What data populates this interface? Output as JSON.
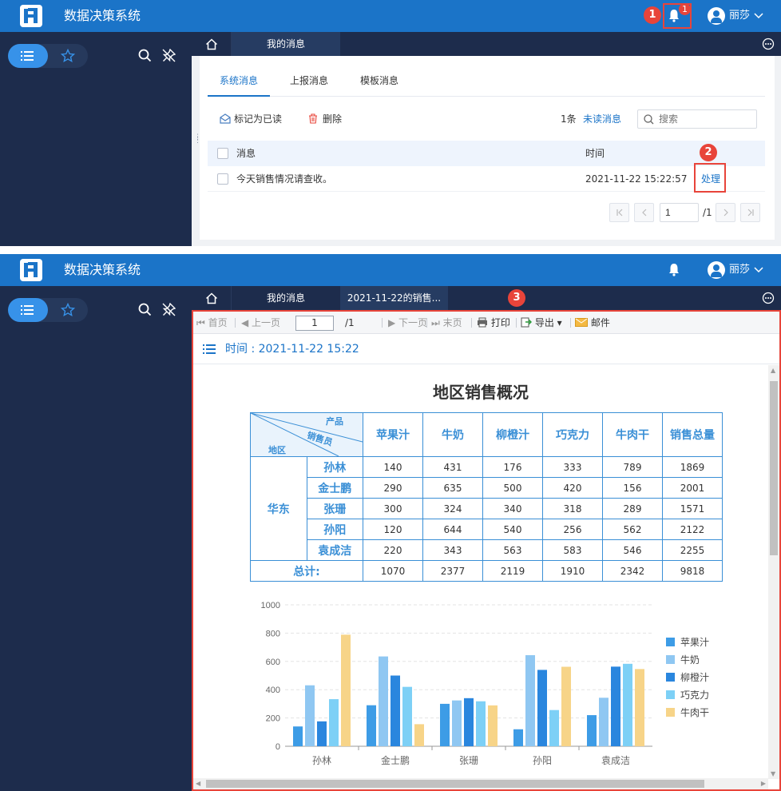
{
  "app": {
    "title": "数据决策系统",
    "user": "丽莎"
  },
  "notifications": {
    "count": "1"
  },
  "markers": {
    "m1": "1",
    "m2": "2",
    "m3": "3"
  },
  "tabs": {
    "messages": "我的消息",
    "report": "2021-11-22的销售..."
  },
  "subtabs": [
    "系统消息",
    "上报消息",
    "模板消息"
  ],
  "actions": {
    "mark_read": "标记为已读",
    "delete": "删除",
    "count": "1条",
    "unread": "未读消息",
    "search_placeholder": "搜索"
  },
  "table": {
    "headers": {
      "message": "消息",
      "time": "时间"
    },
    "rows": [
      {
        "message": "今天销售情况请查收。",
        "time": "2021-11-22 15:22:57",
        "action": "处理"
      }
    ]
  },
  "pager": {
    "page": "1",
    "total": "/1"
  },
  "viewer": {
    "toolbar": {
      "first": "首页",
      "prev": "上一页",
      "page": "1",
      "total": "/1",
      "next": "下一页",
      "last": "末页",
      "print": "打印",
      "export": "导出",
      "mail": "邮件"
    },
    "time": "时间 : 2021-11-22 15:22"
  },
  "report": {
    "title": "地区销售概况",
    "corner": {
      "product": "产品",
      "salesperson": "销售员",
      "region": "地区"
    },
    "columns": [
      "苹果汁",
      "牛奶",
      "柳橙汁",
      "巧克力",
      "牛肉干",
      "销售总量"
    ],
    "region": "华东",
    "rows": [
      {
        "name": "孙林",
        "values": [
          "140",
          "431",
          "176",
          "333",
          "789",
          "1869"
        ]
      },
      {
        "name": "金士鹏",
        "values": [
          "290",
          "635",
          "500",
          "420",
          "156",
          "2001"
        ]
      },
      {
        "name": "张珊",
        "values": [
          "300",
          "324",
          "340",
          "318",
          "289",
          "1571"
        ]
      },
      {
        "name": "孙阳",
        "values": [
          "120",
          "644",
          "540",
          "256",
          "562",
          "2122"
        ]
      },
      {
        "name": "袁成洁",
        "values": [
          "220",
          "343",
          "563",
          "583",
          "546",
          "2255"
        ]
      }
    ],
    "total": {
      "label": "总计:",
      "values": [
        "1070",
        "2377",
        "2119",
        "1910",
        "2342",
        "9818"
      ]
    }
  },
  "colors": {
    "brand": "#1b74c8",
    "sidebar": "#1d2c4c",
    "alert": "#e8443a"
  },
  "chart_data": {
    "type": "bar",
    "categories": [
      "孙林",
      "金士鹏",
      "张珊",
      "孙阳",
      "袁成洁"
    ],
    "series": [
      {
        "name": "苹果汁",
        "values": [
          140,
          290,
          300,
          120,
          220
        ],
        "color": "#3d9ce6"
      },
      {
        "name": "牛奶",
        "values": [
          431,
          635,
          324,
          644,
          343
        ],
        "color": "#8fc7f2"
      },
      {
        "name": "柳橙汁",
        "values": [
          176,
          500,
          340,
          540,
          563
        ],
        "color": "#2a86de"
      },
      {
        "name": "巧克力",
        "values": [
          333,
          420,
          318,
          256,
          583
        ],
        "color": "#7dd0f6"
      },
      {
        "name": "牛肉干",
        "values": [
          789,
          156,
          289,
          562,
          546
        ],
        "color": "#f7d488"
      }
    ],
    "ylim": [
      0,
      1000
    ],
    "yticks": [
      0,
      200,
      400,
      600,
      800,
      1000
    ],
    "grid": true,
    "legend": "right"
  }
}
